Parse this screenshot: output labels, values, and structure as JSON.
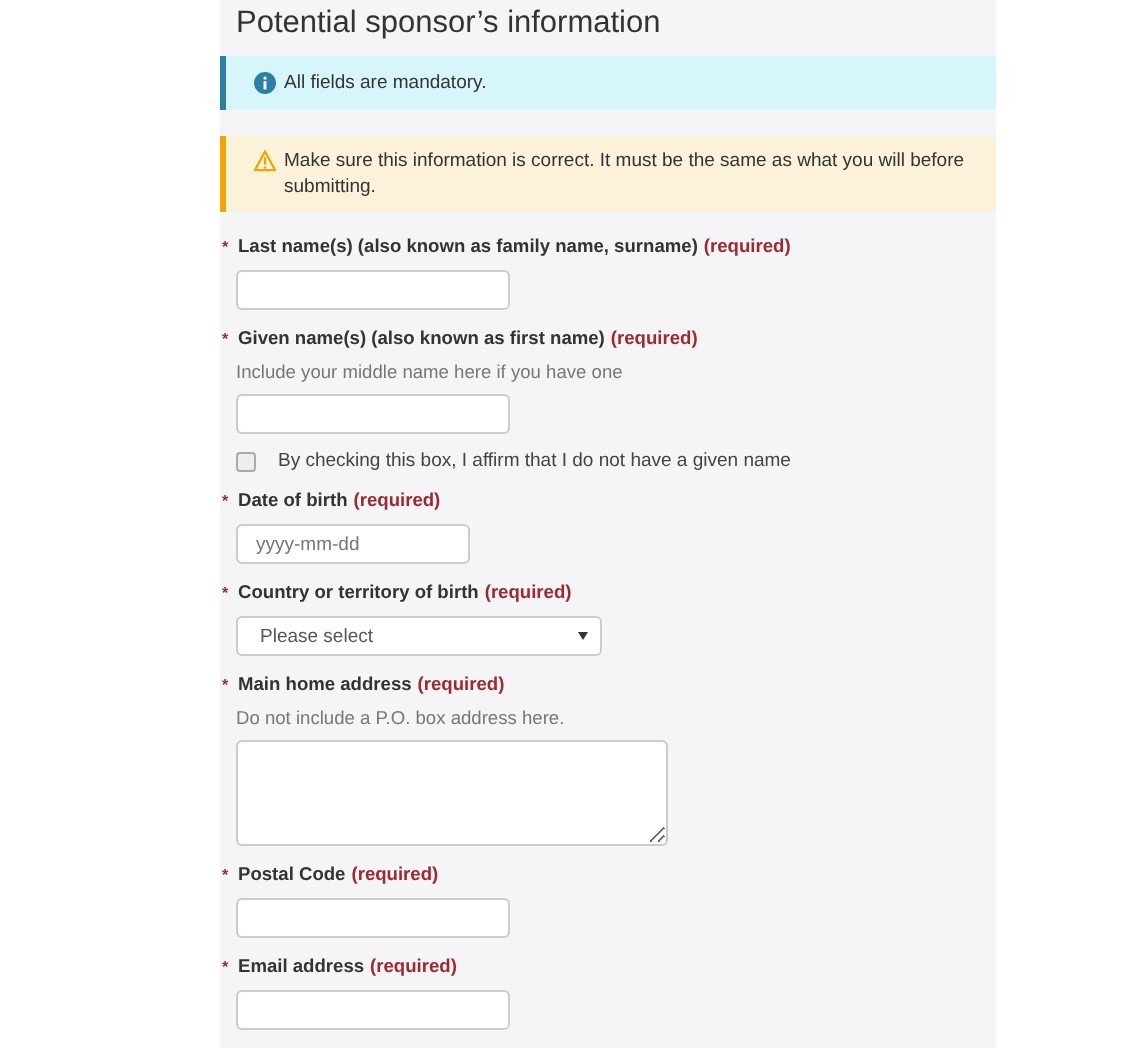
{
  "heading": "Potential sponsor’s information",
  "alerts": [
    {
      "kind": "info",
      "text": "All fields are mandatory."
    },
    {
      "kind": "warning",
      "text": "Make sure this information is correct. It must be the same as what you will before submitting."
    }
  ],
  "fields": [
    {
      "kind": "text",
      "marker": "*",
      "label": "Last name(s) (also known as family name, surname)",
      "required": "(required)"
    },
    {
      "kind": "text",
      "marker": "*",
      "label": "Given name(s) (also known as first name)",
      "required": "(required)",
      "hint": "Include your middle name here if you have one"
    },
    {
      "kind": "checkbox",
      "label": "By checking this box, I affirm that I do not have a given name",
      "checked": false
    },
    {
      "kind": "date",
      "marker": "*",
      "label": "Date of birth",
      "required": "(required)",
      "placeholder": "yyyy-mm-dd"
    },
    {
      "kind": "select",
      "marker": "*",
      "label": "Country or territory of birth",
      "required": "(required)",
      "value": "Please select"
    },
    {
      "kind": "textarea",
      "marker": "*",
      "label": "Main home address",
      "required": "(required)",
      "hint": "Do not include a P.O. box address here."
    },
    {
      "kind": "text",
      "marker": "*",
      "label": "Postal Code",
      "required": "(required)"
    },
    {
      "kind": "text",
      "marker": "*",
      "label": "Email address",
      "required": "(required)"
    }
  ]
}
